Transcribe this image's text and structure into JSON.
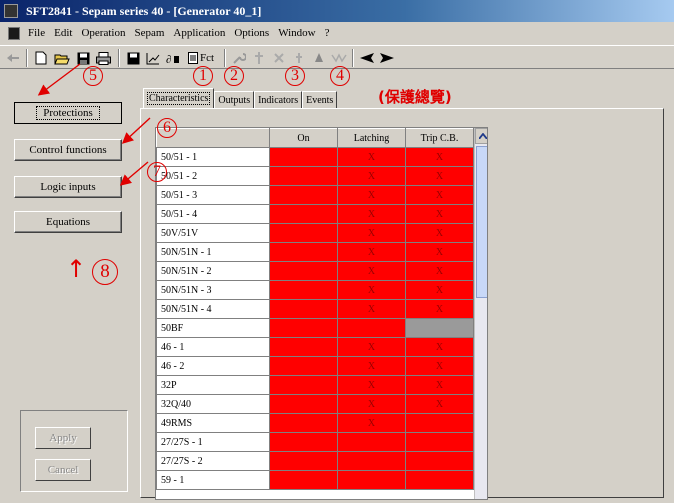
{
  "window": {
    "title": "SFT2841 - Sepam series 40 - [Generator 40_1]"
  },
  "menu": {
    "items": [
      "File",
      "Edit",
      "Operation",
      "Sepam",
      "Application",
      "Options",
      "Window",
      "?"
    ]
  },
  "toolbar": {
    "fct_label": "Fct",
    "icons": [
      "back-icon",
      "new-icon",
      "open-icon",
      "save-icon",
      "print-icon",
      "save-disk-icon",
      "chart-icon",
      "connect-icon",
      "fct-icon",
      "wrench-icon",
      "tool-icon",
      "tool-icon",
      "waveform-icon",
      "arrow-left-icon",
      "arrow-right-icon"
    ]
  },
  "left_nav": {
    "buttons": [
      "Protections",
      "Control functions",
      "Logic inputs",
      "Equations"
    ],
    "apply_label": "Apply",
    "cancel_label": "Cancel"
  },
  "tabs": {
    "items": [
      "Characteristics",
      "Outputs",
      "Indicators",
      "Events"
    ],
    "note": "(保護總覽)"
  },
  "annotations": {
    "n1": "1",
    "n2": "2",
    "n3": "3",
    "n4": "4",
    "n5": "5",
    "n6": "6",
    "n7": "7",
    "n8": "8",
    "arrow_up": "↑"
  },
  "grid": {
    "columns": [
      "On",
      "Latching",
      "Trip C.B."
    ],
    "mark": "X",
    "colors": {
      "cell": "#ff0000",
      "disabled": "#9a9a9a",
      "annotation": "#e00000"
    },
    "rows": [
      {
        "name": "50/51 - 1",
        "latching": true,
        "trip": true,
        "trip_disabled": false
      },
      {
        "name": "50/51 - 2",
        "latching": true,
        "trip": true,
        "trip_disabled": false
      },
      {
        "name": "50/51 - 3",
        "latching": true,
        "trip": true,
        "trip_disabled": false
      },
      {
        "name": "50/51 - 4",
        "latching": true,
        "trip": true,
        "trip_disabled": false
      },
      {
        "name": "50V/51V",
        "latching": true,
        "trip": true,
        "trip_disabled": false
      },
      {
        "name": "50N/51N - 1",
        "latching": true,
        "trip": true,
        "trip_disabled": false
      },
      {
        "name": "50N/51N - 2",
        "latching": true,
        "trip": true,
        "trip_disabled": false
      },
      {
        "name": "50N/51N - 3",
        "latching": true,
        "trip": true,
        "trip_disabled": false
      },
      {
        "name": "50N/51N - 4",
        "latching": true,
        "trip": true,
        "trip_disabled": false
      },
      {
        "name": "50BF",
        "latching": false,
        "trip": false,
        "trip_disabled": true
      },
      {
        "name": "46 - 1",
        "latching": true,
        "trip": true,
        "trip_disabled": false
      },
      {
        "name": "46 - 2",
        "latching": true,
        "trip": true,
        "trip_disabled": false
      },
      {
        "name": "32P",
        "latching": true,
        "trip": true,
        "trip_disabled": false
      },
      {
        "name": "32Q/40",
        "latching": true,
        "trip": true,
        "trip_disabled": false
      },
      {
        "name": "49RMS",
        "latching": true,
        "trip": false,
        "trip_disabled": false
      },
      {
        "name": "27/27S - 1",
        "latching": false,
        "trip": false,
        "trip_disabled": false
      },
      {
        "name": "27/27S - 2",
        "latching": false,
        "trip": false,
        "trip_disabled": false
      },
      {
        "name": "59 - 1",
        "latching": false,
        "trip": false,
        "trip_disabled": false
      }
    ]
  }
}
